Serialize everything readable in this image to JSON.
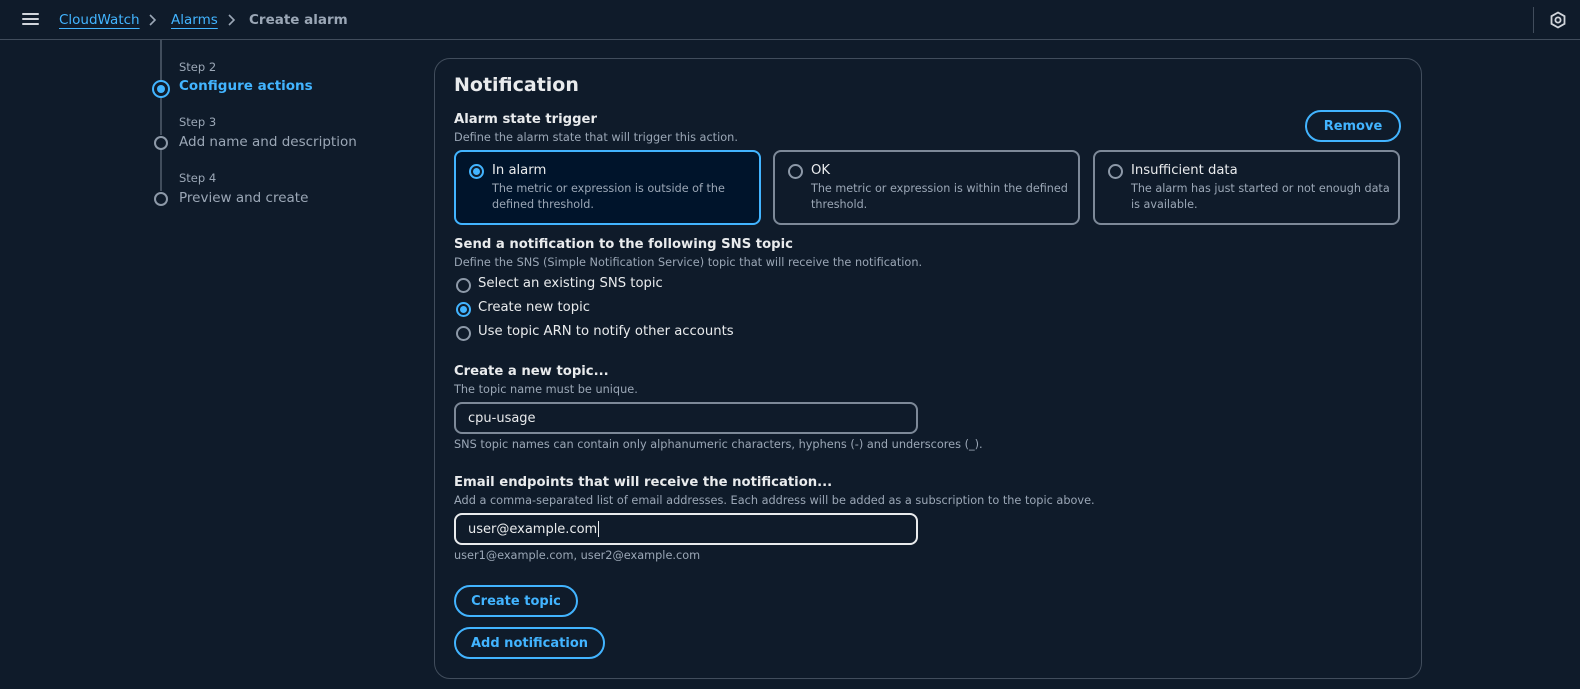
{
  "breadcrumb": {
    "items": [
      "CloudWatch",
      "Alarms",
      "Create alarm"
    ]
  },
  "icons": {
    "menu": "hamburger-menu-icon",
    "chevron": "chevron-right-icon",
    "settings": "settings-icon"
  },
  "steps": [
    {
      "number": "Step 2",
      "title": "Configure actions",
      "state": "active"
    },
    {
      "number": "Step 3",
      "title": "Add name and description",
      "state": "pending"
    },
    {
      "number": "Step 4",
      "title": "Preview and create",
      "state": "pending"
    }
  ],
  "notification": {
    "title": "Notification",
    "remove_label": "Remove",
    "alarm_state": {
      "label": "Alarm state trigger",
      "description": "Define the alarm state that will trigger this action.",
      "options": [
        {
          "title": "In alarm",
          "description": "The metric or expression is outside of the defined threshold.",
          "selected": true
        },
        {
          "title": "OK",
          "description": "The metric or expression is within the defined threshold.",
          "selected": false
        },
        {
          "title": "Insufficient data",
          "description": "The alarm has just started or not enough data is available.",
          "selected": false
        }
      ]
    },
    "sns": {
      "label": "Send a notification to the following SNS topic",
      "description": "Define the SNS (Simple Notification Service) topic that will receive the notification.",
      "options": [
        {
          "label": "Select an existing SNS topic",
          "selected": false
        },
        {
          "label": "Create new topic",
          "selected": true
        },
        {
          "label": "Use topic ARN to notify other accounts",
          "selected": false
        }
      ]
    },
    "new_topic": {
      "label": "Create a new topic...",
      "description": "The topic name must be unique.",
      "value": "cpu-usage",
      "constraint": "SNS topic names can contain only alphanumeric characters, hyphens (-) and underscores (_)."
    },
    "email": {
      "label": "Email endpoints that will receive the notification...",
      "description": "Add a comma-separated list of email addresses. Each address will be added as a subscription to the topic above.",
      "value": "user@example.com",
      "hint": "user1@example.com, user2@example.com"
    },
    "create_topic_label": "Create topic",
    "add_notification_label": "Add notification"
  },
  "colors": {
    "background": "#0f1b2a",
    "accent": "#42b4ff",
    "border": "#414d5c",
    "text": "#e9ebed",
    "muted": "#9ba7b6"
  }
}
